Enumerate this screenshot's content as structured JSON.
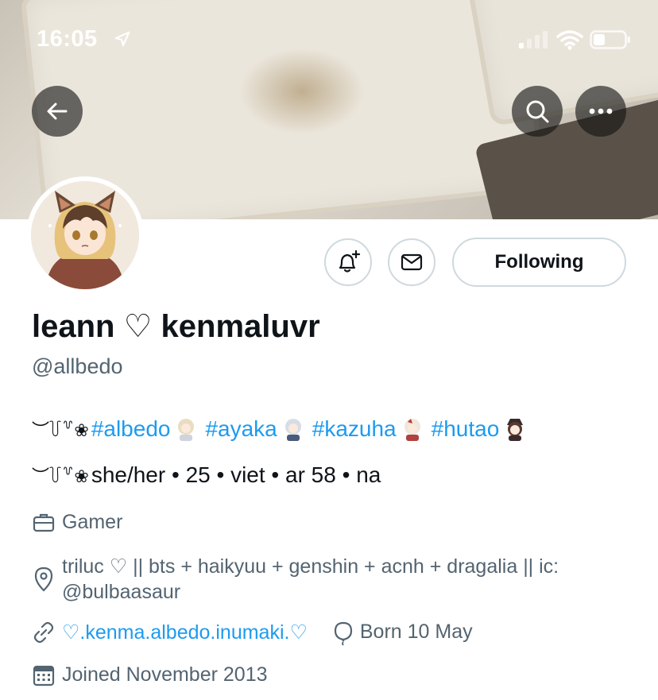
{
  "status_bar": {
    "time": "16:05"
  },
  "profile": {
    "display_name": "leann ♡ kenmaluvr",
    "handle": "@allbedo",
    "follow_label": "Following",
    "bio": {
      "line1": {
        "deco": "︶꒦꒷❀",
        "hashtags": [
          "#albedo",
          "#ayaka",
          "#kazuha",
          "#hutao"
        ]
      },
      "line2": {
        "deco": "︶꒦꒷❀",
        "text": "she/her • 25 • viet • ar 58 • na"
      }
    },
    "category": "Gamer",
    "location": "triluc ♡ || bts + haikyuu + genshin + acnh + dragalia || ic: @bulbaasaur",
    "website": "♡.kenma.albedo.inumaki.♡",
    "birthday": "Born 10 May",
    "joined": "Joined November 2013"
  },
  "colors": {
    "accent": "#1d9bf0",
    "secondary_text": "#536471",
    "border": "#cfd9de"
  },
  "icons": {
    "back": "arrow-left-icon",
    "search": "search-icon",
    "more": "more-horizontal-icon",
    "notify": "bell-plus-icon",
    "message": "envelope-icon",
    "category": "briefcase-icon",
    "location": "map-pin-icon",
    "website": "link-icon",
    "birthday": "balloon-icon",
    "joined": "calendar-icon"
  }
}
